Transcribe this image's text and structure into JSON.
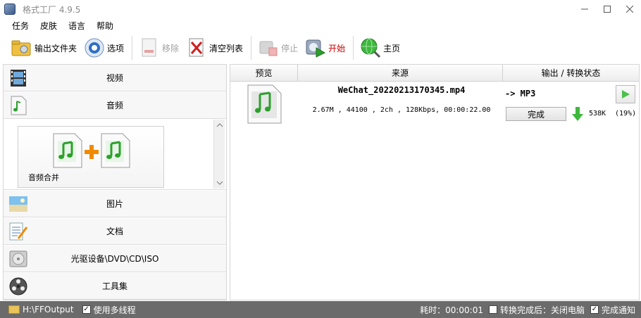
{
  "window": {
    "title": "格式工厂 4.9.5"
  },
  "menu": [
    "任务",
    "皮肤",
    "语言",
    "帮助"
  ],
  "toolbar": {
    "output_folder": "输出文件夹",
    "options": "选项",
    "remove": "移除",
    "clear_list": "清空列表",
    "stop": "停止",
    "start": "开始",
    "home": "主页"
  },
  "sidebar": {
    "video": "视频",
    "audio": "音频",
    "audio_merge": "音频合并",
    "picture": "图片",
    "document": "文档",
    "rom_device": "光驱设备\\DVD\\CD\\ISO",
    "toolbox": "工具集"
  },
  "task_list": {
    "headers": {
      "preview": "预览",
      "source": "来源",
      "output_status": "输出 / 转换状态"
    },
    "rows": [
      {
        "filename": "WeChat_20220213170345.mp4",
        "info": "2.67M , 44100 , 2ch , 128Kbps, 00:00:22.00",
        "target": "-> MP3",
        "status": "完成",
        "size": "538K",
        "percent": "(19%)"
      }
    ]
  },
  "statusbar": {
    "output_path": "H:\\FFOutput",
    "multithread_label": "使用多线程",
    "multithread_checked": true,
    "elapsed": "耗时：00:00:01",
    "shutdown_label": "转换完成后：关闭电脑",
    "shutdown_checked": false,
    "notify_label": "完成通知",
    "notify_checked": true
  },
  "colors": {
    "accent_green": "#3db83d",
    "statusbar_bg": "#6b6b6b",
    "start_red": "#d00000"
  }
}
